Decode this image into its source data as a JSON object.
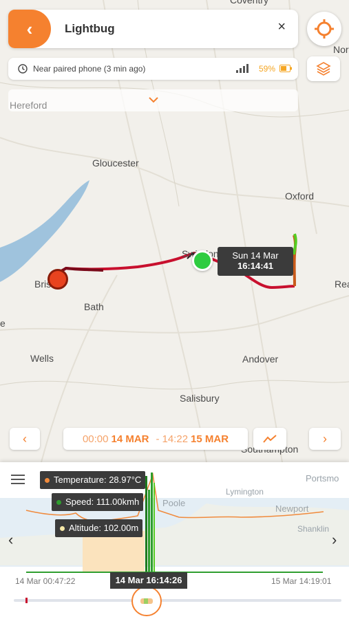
{
  "header": {
    "back_icon": "chevron-left-icon",
    "device_name": "Lightbug",
    "close_label": "×"
  },
  "status": {
    "text": "Near paired phone (3 min ago)",
    "battery": "59%"
  },
  "dropdown": {
    "placeholder": "Hereford",
    "arrow": "⌄"
  },
  "map": {
    "places": [
      "Coventry",
      "Nor",
      "Hereford",
      "Gloucester",
      "Oxford",
      "Swindon",
      "Rea",
      "Bristol",
      "Bath",
      "e",
      "Wells",
      "Andover",
      "Salisbury",
      "Southampton"
    ],
    "tooltip": {
      "date": "Sun 14 Mar",
      "time": "16:14:41"
    }
  },
  "range": {
    "start_time": "00:00",
    "start_date": "14 MAR",
    "separator": "-",
    "end_time": "14:22",
    "end_date": "15 MAR",
    "prev": "‹",
    "next": "›"
  },
  "chart": {
    "tooltips": {
      "temperature": "Temperature: 28.97°C",
      "speed": "Speed: 111.00kmh",
      "altitude": "Altitude: 102.00m"
    },
    "start_label": "14 Mar 00:47:22",
    "end_label": "15 Mar 14:19:01",
    "cursor_label": "14 Mar 16:14:26",
    "map_places": [
      "Portsmo",
      "Lymington",
      "Poole",
      "Newport",
      "Shanklin"
    ],
    "nav_prev": "‹",
    "nav_next": "›"
  },
  "chart_data": {
    "type": "line",
    "x_range": [
      "14 Mar 00:47:22",
      "15 Mar 14:19:01"
    ],
    "series": [
      {
        "name": "Temperature",
        "color": "#f08a3c",
        "unit": "°C",
        "value_at_cursor": 28.97
      },
      {
        "name": "Speed",
        "color": "#2e9e2e",
        "unit": "kmh",
        "value_at_cursor": 111.0
      },
      {
        "name": "Altitude",
        "color": "#f7d9a8",
        "unit": "m",
        "value_at_cursor": 102.0
      }
    ],
    "cursor_x": "14 Mar 16:14:26"
  },
  "colors": {
    "accent": "#f5812f",
    "route": "#c8102e",
    "start_marker": "#2ecc40",
    "end_marker": "#e8431f"
  }
}
